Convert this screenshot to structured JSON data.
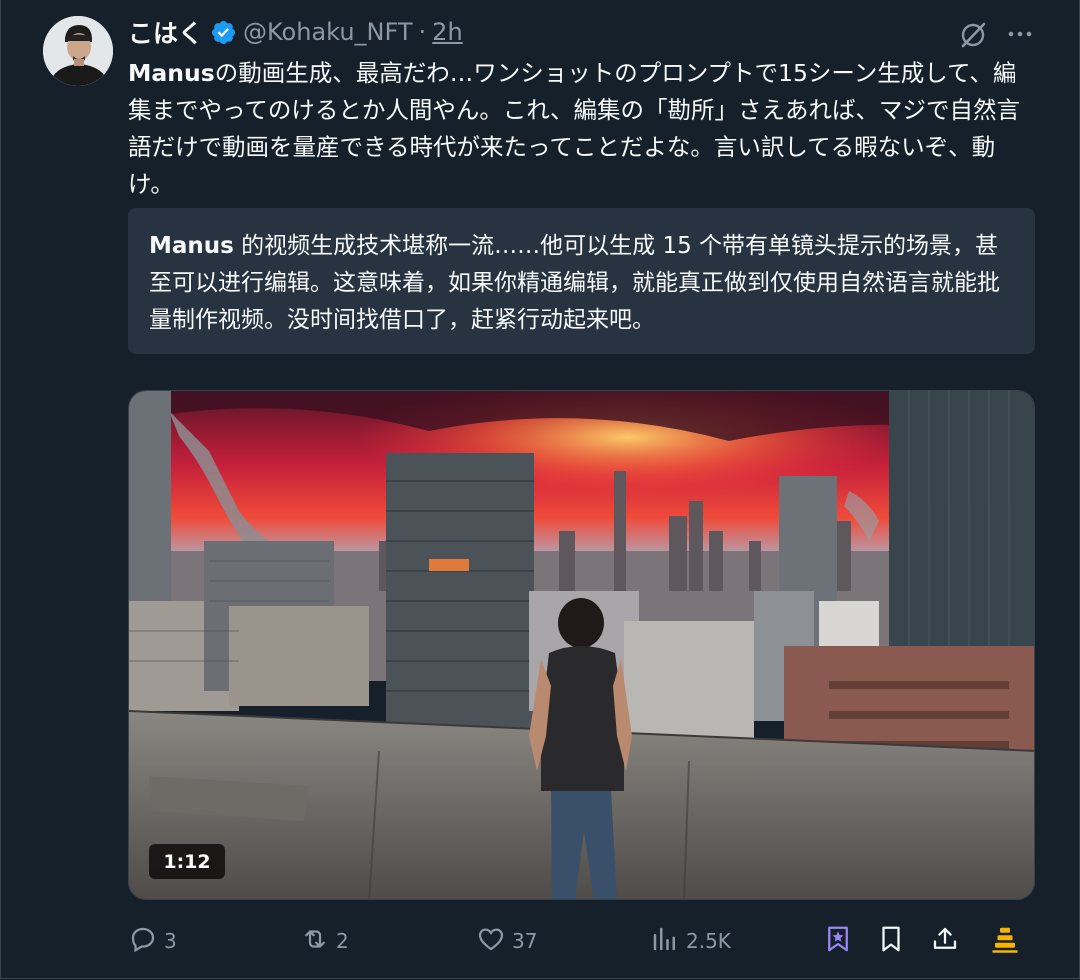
{
  "author": {
    "display_name": "こはく",
    "handle": "@Kohaku_NFT",
    "separator": "·",
    "time": "2h"
  },
  "tweet": {
    "brand": "Manus",
    "text_rest": "の動画生成、最高だわ…ワンショットのプロンプトで15シーン生成して、編集までやってのけるとか人間やん。これ、編集の「勘所」さえあれば、マジで自然言語だけで動画を量産できる時代が来たってことだよな。言い訳してる暇ないぞ、動け。"
  },
  "translation": {
    "brand": "Manus",
    "text_rest": " 的视频生成技术堪称一流……他可以生成 15 个带有单镜头提示的场景，甚至可以进行编辑。这意味着，如果你精通编辑，就能真正做到仅使用自然语言就能批量制作视频。没时间找借口了，赶紧行动起来吧。"
  },
  "media": {
    "duration": "1:12"
  },
  "actions": {
    "replies": "3",
    "retweets": "2",
    "likes": "37",
    "views": "2.5K"
  },
  "colors": {
    "background": "#15202b",
    "text": "#f7f9f9",
    "muted": "#8b98a5",
    "verified": "#1d9bf0",
    "grok_purple": "#9b87f5",
    "premium_gold": "#f7b500"
  },
  "icons": [
    "verified-badge-icon",
    "grok-icon",
    "more-icon",
    "reply-icon",
    "retweet-icon",
    "like-icon",
    "views-icon",
    "grok-bookmark-icon",
    "bookmark-icon",
    "share-icon",
    "premium-icon"
  ]
}
